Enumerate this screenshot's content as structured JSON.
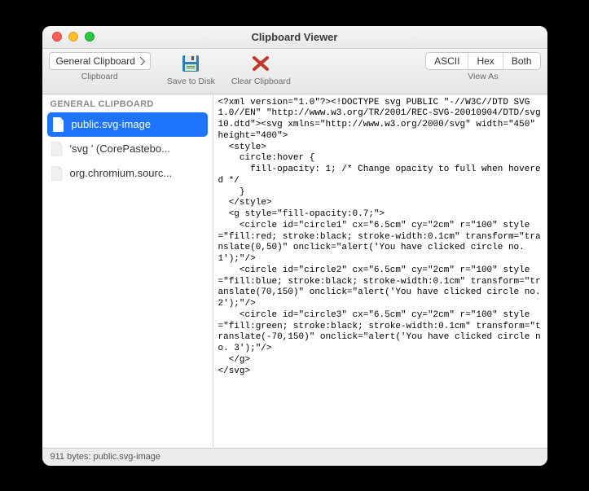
{
  "window": {
    "title": "Clipboard Viewer"
  },
  "toolbar": {
    "clipboard_selector": "General Clipboard",
    "clipboard_label": "Clipboard",
    "save_label": "Save to Disk",
    "clear_label": "Clear Clipboard",
    "viewas_label": "View As",
    "seg": {
      "ascii": "ASCII",
      "hex": "Hex",
      "both": "Both"
    }
  },
  "sidebar": {
    "header": "GENERAL CLIPBOARD",
    "items": [
      {
        "label": "public.svg-image",
        "selected": true
      },
      {
        "label": "'svg ' (CorePastebo...",
        "selected": false
      },
      {
        "label": "org.chromium.sourc...",
        "selected": false
      }
    ]
  },
  "content": {
    "text": "<?xml version=\"1.0\"?><!DOCTYPE svg PUBLIC \"-//W3C//DTD SVG 1.0//EN\" \"http://www.w3.org/TR/2001/REC-SVG-20010904/DTD/svg10.dtd\"><svg xmlns=\"http://www.w3.org/2000/svg\" width=\"450\" height=\"400\">\n  <style>\n    circle:hover {\n      fill-opacity: 1; /* Change opacity to full when hovered */\n    }\n  </style>\n  <g style=\"fill-opacity:0.7;\">\n    <circle id=\"circle1\" cx=\"6.5cm\" cy=\"2cm\" r=\"100\" style=\"fill:red; stroke:black; stroke-width:0.1cm\" transform=\"translate(0,50)\" onclick=\"alert('You have clicked circle no. 1');\"/>\n    <circle id=\"circle2\" cx=\"6.5cm\" cy=\"2cm\" r=\"100\" style=\"fill:blue; stroke:black; stroke-width:0.1cm\" transform=\"translate(70,150)\" onclick=\"alert('You have clicked circle no. 2');\"/>\n    <circle id=\"circle3\" cx=\"6.5cm\" cy=\"2cm\" r=\"100\" style=\"fill:green; stroke:black; stroke-width:0.1cm\" transform=\"translate(-70,150)\" onclick=\"alert('You have clicked circle no. 3');\"/>\n  </g>\n</svg>"
  },
  "statusbar": {
    "text": "911 bytes: public.svg-image"
  }
}
